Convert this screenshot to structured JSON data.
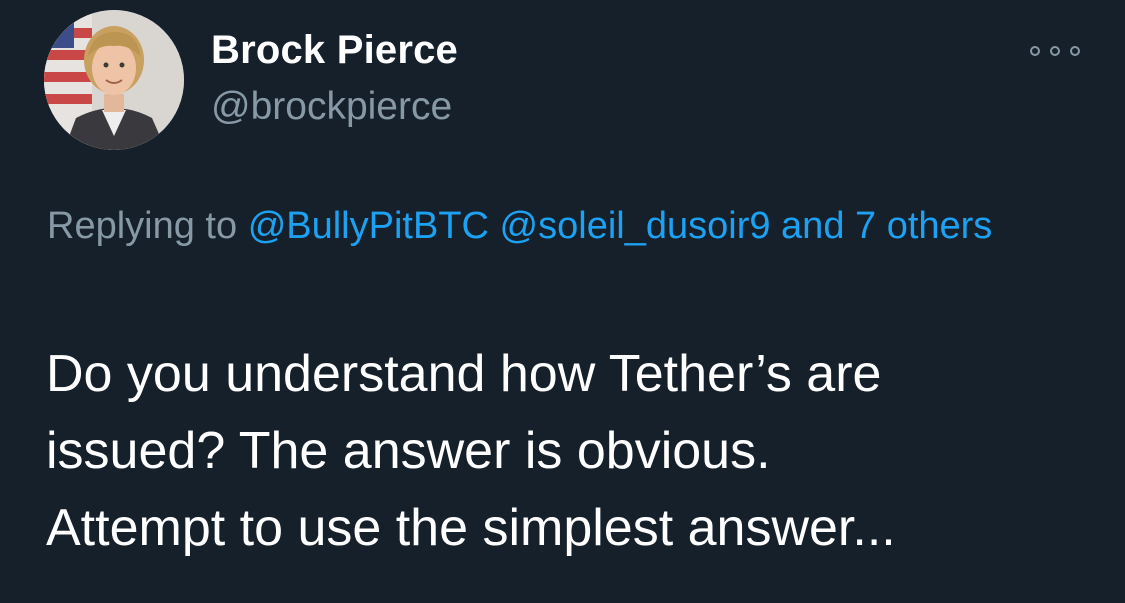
{
  "tweet": {
    "author": {
      "name": "Brock Pierce",
      "handle": "@brockpierce",
      "avatar_icon": "profile-photo"
    },
    "more_icon": "more-options-icon",
    "reply_context": {
      "prefix": "Replying to",
      "mentions": [
        "@BullyPitBTC",
        "@soleil_dusoir9"
      ],
      "others": "and 7 others"
    },
    "text_lines": [
      "Do you understand how Tether’s are",
      "issued? The answer is obvious.",
      "Attempt to use the simplest answer..."
    ]
  },
  "colors": {
    "background": "#15202b",
    "primary_text": "#ffffff",
    "secondary_text": "#8899a6",
    "link": "#1da1f2"
  }
}
